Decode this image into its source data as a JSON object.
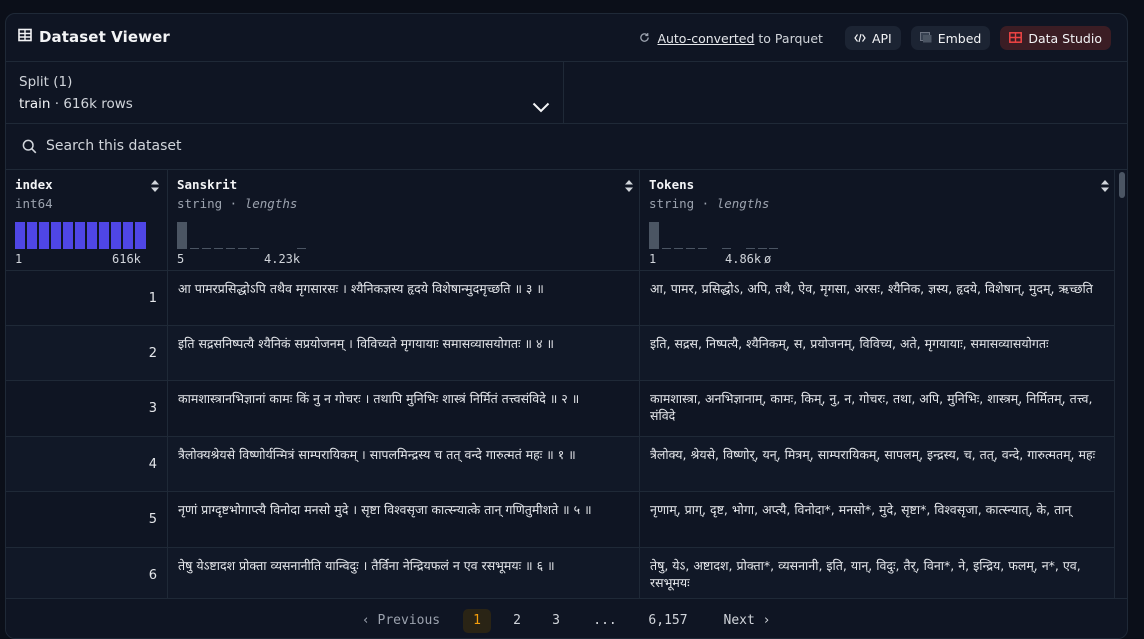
{
  "header": {
    "title": "Dataset Viewer",
    "auto_link": "Auto-converted",
    "auto_suffix": "to Parquet",
    "api_label": "API",
    "embed_label": "Embed",
    "studio_label": "Data Studio"
  },
  "split": {
    "label": "Split (1)",
    "name": "train",
    "rows": "616k rows"
  },
  "search": {
    "placeholder": "Search this dataset"
  },
  "columns": [
    {
      "name": "index",
      "type": "int64",
      "stat": "",
      "min": "1",
      "max": "616k"
    },
    {
      "name": "Sanskrit",
      "type": "string",
      "stat": "lengths",
      "min": "5",
      "max": "4.23k"
    },
    {
      "name": "Tokens",
      "type": "string",
      "stat": "lengths",
      "min": "1",
      "max": "4.86k"
    }
  ],
  "rows": [
    {
      "index": "1",
      "sanskrit": "आ पामरप्रसिद्धोऽपि तथैव मृगसारसः । श्यैनिकज्ञस्य हृदये विशेषान्मुदमृच्छति ॥ ३ ॥",
      "tokens": "आ, पामर, प्रसिद्धोऽ, अपि, तथै, ऐव, मृगसा, अरसः, श्यैनिक, ज्ञस्य, हृदये, विशेषान्, मुदम्, ऋच्छति"
    },
    {
      "index": "2",
      "sanskrit": "इति सद्रसनिष्पत्यै श्यैनिकं सप्रयोजनम् । विविच्यते मृगयायाः समासव्यासयोगतः ॥ ४ ॥",
      "tokens": "इति, सद्रस, निष्पत्यै, श्यैनिकम्, स, प्रयोजनम्, विविच्य, अते, मृगयायाः, समासव्यासयोगतः"
    },
    {
      "index": "3",
      "sanskrit": "कामशास्त्रानभिज्ञानां कामः किं नु न गोचरः । तथापि मुनिभिः शास्त्रं निर्मितं तत्त्वसंविदे ॥ २ ॥",
      "tokens": "कामशास्त्रा, अनभिज्ञानाम्, कामः, किम्, नु, न, गोचरः, तथा, अपि, मुनिभिः, शास्त्रम्, निर्मितम्, तत्त्व, संविदे"
    },
    {
      "index": "4",
      "sanskrit": "त्रैलोक्यश्रेयसे विष्णोर्यन्मित्रं साम्परायिकम् । सापलमिन्द्रस्य च तत् वन्दे गारुत्मतं महः ॥ १ ॥",
      "tokens": "त्रैलोक्य, श्रेयसे, विष्णोर्, यन्, मित्रम्, साम्परायिकम्, सापलम्, इन्द्रस्य, च, तत्, वन्दे, गारुत्मतम्, महः"
    },
    {
      "index": "5",
      "sanskrit": "नृणां प्राग्दृष्टभोगाप्त्यै विनोदा मनसो मुदे । सृष्टा विश्वसृजा कात्स्न्यात्के तान् गणितुमीशते ॥ ५ ॥",
      "tokens": "नृणाम्, प्राग्, दृष्ट, भोगा, अप्त्यै, विनोदा*, मनसो*, मुदे, सृष्टा*, विश्वसृजा, कात्स्न्यात्, के, तान्"
    },
    {
      "index": "6",
      "sanskrit": "तेषु येऽष्टादश प्रोक्ता व्यसनानीति यान्विदुः । तैर्विना नेन्द्रियफलं न एव रसभूमयः ॥ ६ ॥",
      "tokens": "तेषु, येऽ, अष्टादश, प्रोक्ता*, व्यसनानी, इति, यान्, विदुः, तैर्, विना*, ने, इन्द्रिय, फलम्, न*, एव, रसभूमयः"
    }
  ],
  "pagination": {
    "prev": "Previous",
    "pages": [
      "1",
      "2",
      "3",
      "...",
      "6,157"
    ],
    "next": "Next",
    "current": "1"
  },
  "colors": {
    "accent": "#f59e0b",
    "histogram_index": "#4f46e5",
    "histogram_string": "#4b5563",
    "studio_red": "#ef4444"
  }
}
